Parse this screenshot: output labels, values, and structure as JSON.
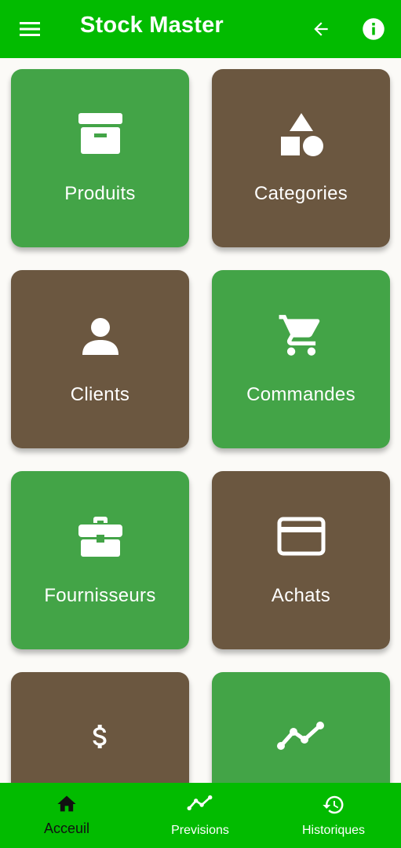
{
  "app_bar": {
    "title": "Stock Master",
    "menu_icon": "menu-icon",
    "back_icon": "arrow-back-icon",
    "info_icon": "info-icon",
    "color": "#02bb00"
  },
  "tiles": [
    {
      "label": "Produits",
      "icon": "archive-box-icon",
      "color": "#43a447"
    },
    {
      "label": "Categories",
      "icon": "shapes-icon",
      "color": "#6b5740"
    },
    {
      "label": "Clients",
      "icon": "person-icon",
      "color": "#6b5740"
    },
    {
      "label": "Commandes",
      "icon": "shopping-cart-icon",
      "color": "#43a447"
    },
    {
      "label": "Fournisseurs",
      "icon": "briefcase-icon",
      "color": "#43a447"
    },
    {
      "label": "Achats",
      "icon": "credit-card-icon",
      "color": "#6b5740"
    },
    {
      "label": "",
      "icon": "dollar-icon",
      "color": "#6b5740"
    },
    {
      "label": "",
      "icon": "trend-line-icon",
      "color": "#43a447"
    }
  ],
  "bottom_nav": {
    "items": [
      {
        "label": "Acceuil",
        "icon": "home-icon",
        "active": true
      },
      {
        "label": "Previsions",
        "icon": "trend-line-icon",
        "active": false
      },
      {
        "label": "Historiques",
        "icon": "history-icon",
        "active": false
      }
    ],
    "color": "#02bb00"
  }
}
